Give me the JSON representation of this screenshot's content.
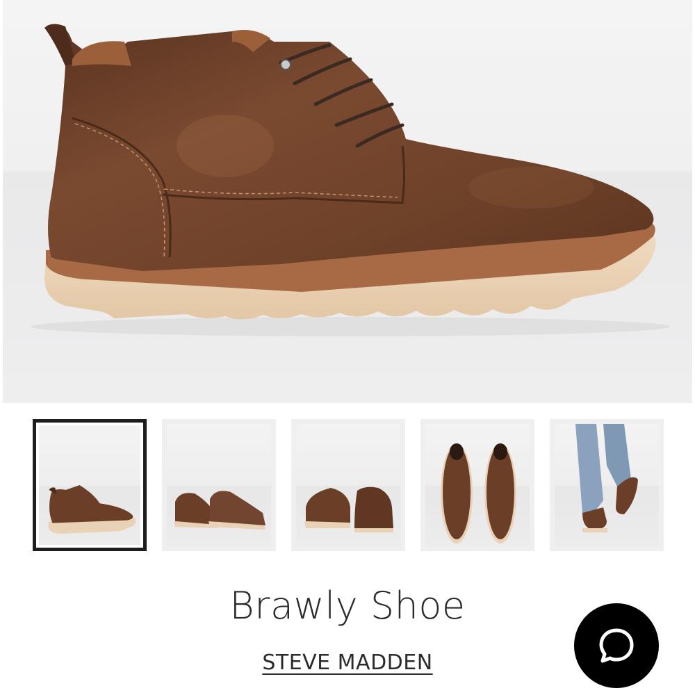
{
  "product": {
    "title": "Brawly Shoe",
    "brand": "STEVE MADDEN"
  },
  "gallery": {
    "main_image": "boot-side-view",
    "thumbnails": [
      {
        "view": "single-boot-side",
        "selected": true
      },
      {
        "view": "pair-angled-front",
        "selected": false
      },
      {
        "view": "pair-back-view",
        "selected": false
      },
      {
        "view": "pair-top-view",
        "selected": false
      },
      {
        "view": "on-model-jeans",
        "selected": false
      }
    ]
  },
  "chat": {
    "icon": "chat-bubble-icon"
  },
  "colors": {
    "leather": "#6b3f27",
    "sole": "#ead2b6",
    "chat_button": "#000000",
    "selected_border": "#1e1e1e"
  }
}
